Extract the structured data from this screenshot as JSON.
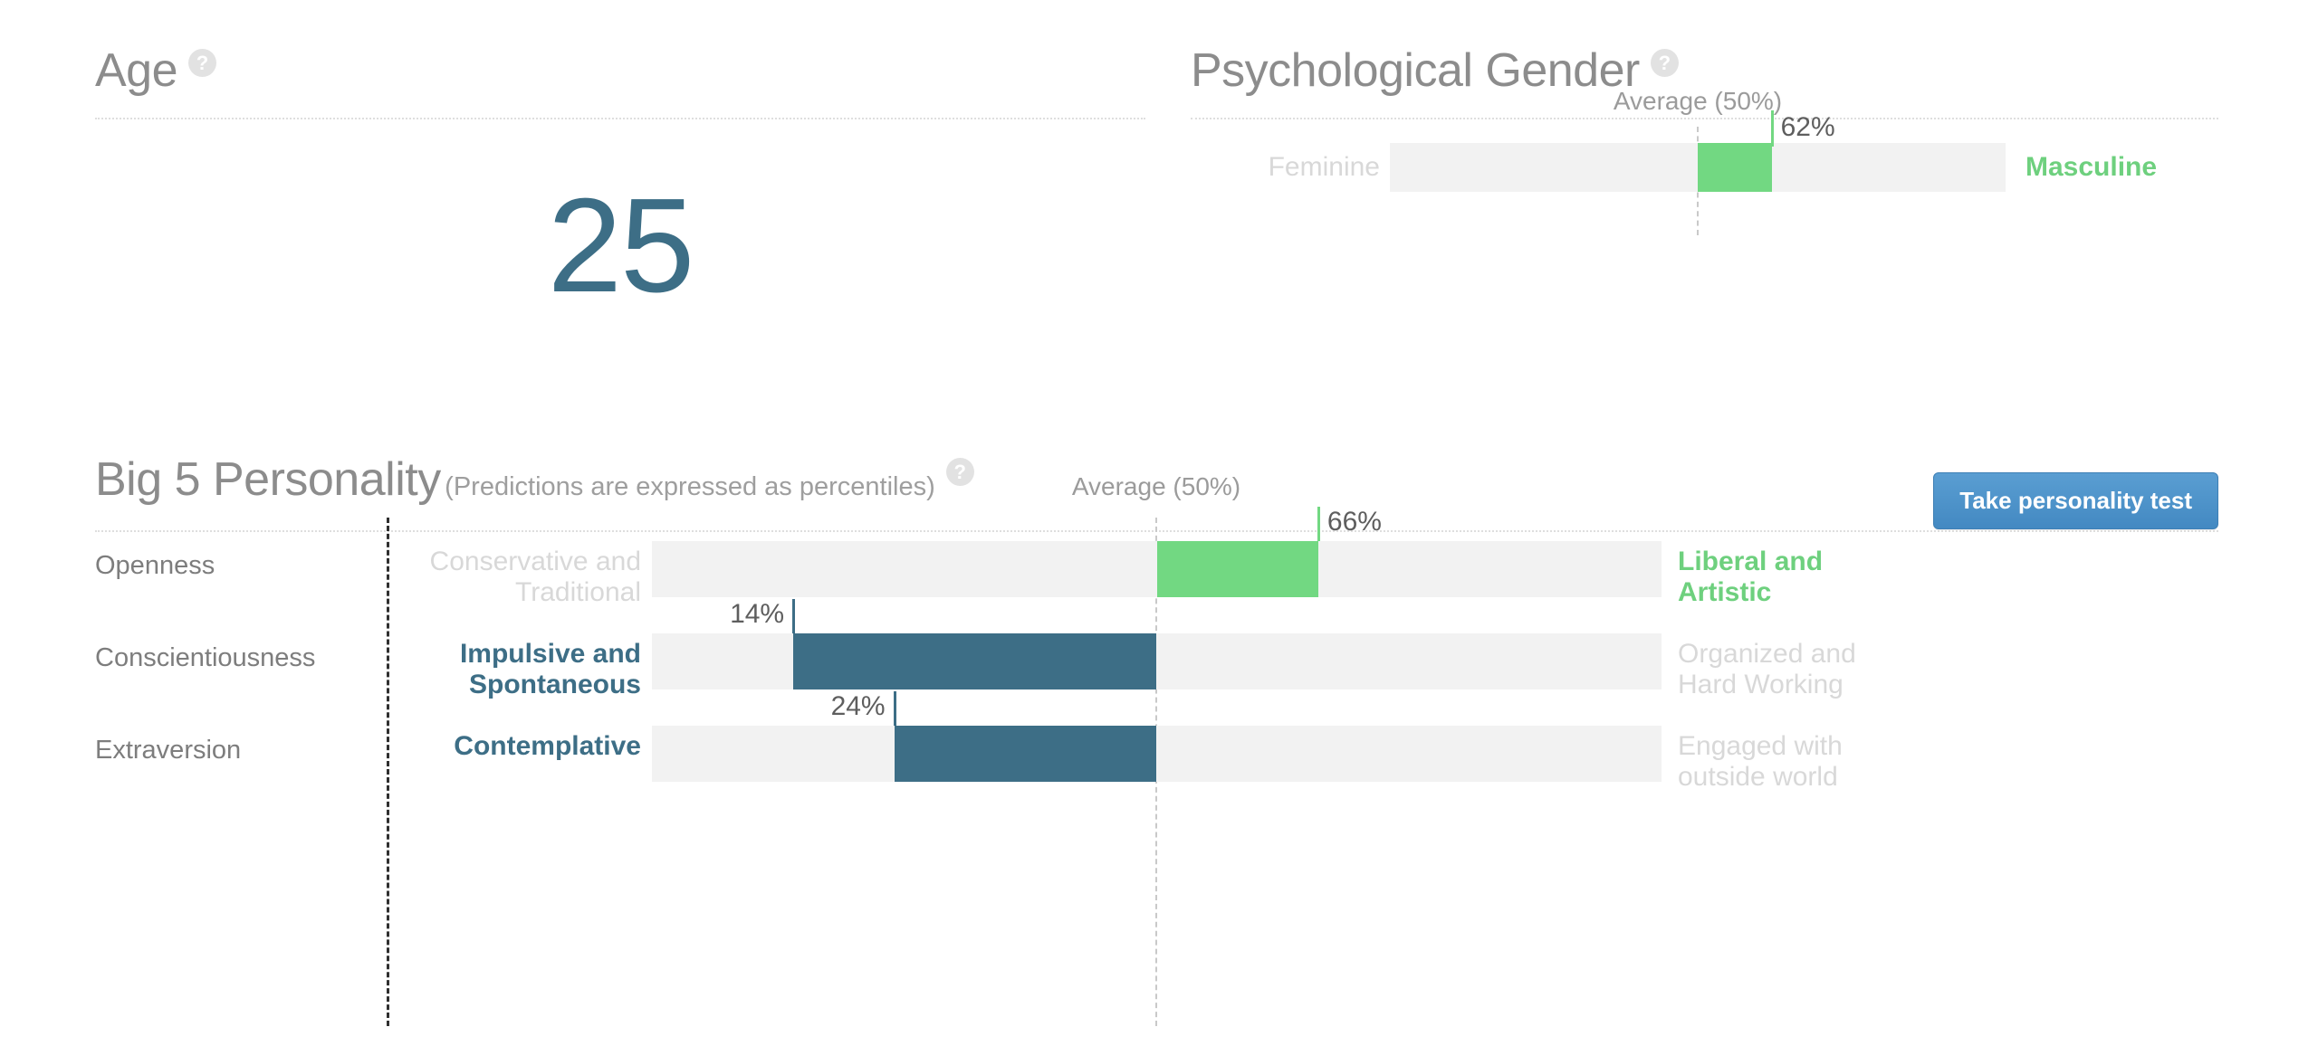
{
  "age": {
    "title": "Age",
    "help_icon": "question-mark-icon",
    "value": "25"
  },
  "gender": {
    "title": "Psychological Gender",
    "help_icon": "question-mark-icon",
    "average_label": "Average (50%)",
    "left_label": "Feminine",
    "right_label": "Masculine",
    "percent_label": "62%",
    "value": 62
  },
  "big5": {
    "title": "Big 5 Personality",
    "subtitle": "(Predictions are expressed as percentiles)",
    "help_icon": "question-mark-icon",
    "button_label": "Take personality test",
    "average_label": "Average (50%)",
    "rows": [
      {
        "name": "Openness",
        "left_label": "Conservative and\nTraditional",
        "right_label": "Liberal and\nArtistic",
        "percent_label": "66%",
        "value": 66,
        "direction": "right",
        "color": "green"
      },
      {
        "name": "Conscientiousness",
        "left_label": "Impulsive and\nSpontaneous",
        "right_label": "Organized and\nHard Working",
        "percent_label": "14%",
        "value": 14,
        "direction": "left",
        "color": "teal"
      },
      {
        "name": "Extraversion",
        "left_label": "Contemplative",
        "right_label": "Engaged with\noutside world",
        "percent_label": "24%",
        "value": 24,
        "direction": "left",
        "color": "teal"
      }
    ]
  },
  "chart_data": {
    "type": "bar",
    "title": "Big 5 Personality",
    "subtitle": "(Predictions are expressed as percentiles)",
    "orientation": "horizontal-diverging",
    "baseline": 50,
    "xlim": [
      0,
      100
    ],
    "unit": "percentile",
    "grid": false,
    "annotations": [
      "Average (50%)"
    ],
    "categories": [
      "Psychological Gender",
      "Openness",
      "Conscientiousness",
      "Extraversion"
    ],
    "values": [
      62,
      66,
      14,
      24
    ],
    "series": [
      {
        "name": "percentile",
        "points": [
          {
            "label": "Psychological Gender",
            "value": 62,
            "low_pole": "Feminine",
            "high_pole": "Masculine",
            "color": "#72d882"
          },
          {
            "label": "Openness",
            "value": 66,
            "low_pole": "Conservative and Traditional",
            "high_pole": "Liberal and Artistic",
            "color": "#72d882"
          },
          {
            "label": "Conscientiousness",
            "value": 14,
            "low_pole": "Impulsive and Spontaneous",
            "high_pole": "Organized and Hard Working",
            "color": "#3d6e86"
          },
          {
            "label": "Extraversion",
            "value": 24,
            "low_pole": "Contemplative",
            "high_pole": "Engaged with outside world",
            "color": "#3d6e86"
          }
        ]
      }
    ],
    "colors": {
      "above_average": "#72d882",
      "below_average": "#3d6e86",
      "track": "#f2f2f2",
      "accent_button": "#4f94cb",
      "age_value": "#3d6e86"
    }
  }
}
